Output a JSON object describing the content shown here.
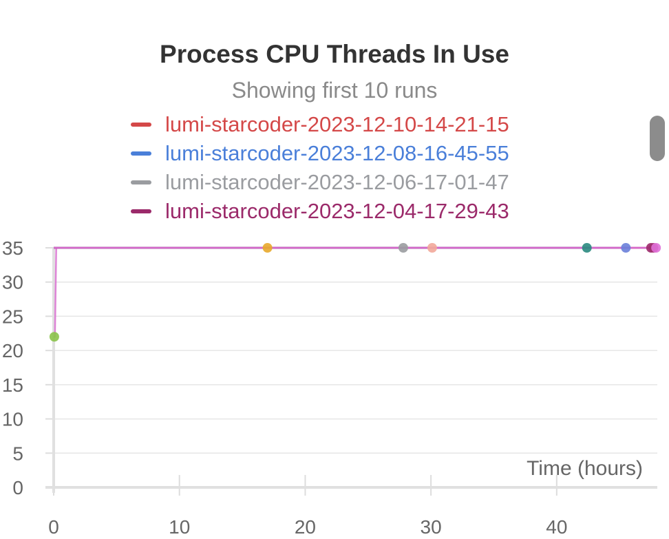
{
  "chart_data": {
    "type": "line",
    "title": "Process CPU Threads In Use",
    "subtitle": "Showing first 10 runs",
    "xlabel": "Time (hours)",
    "ylabel": "",
    "xlim": [
      0,
      48
    ],
    "ylim": [
      0,
      35
    ],
    "x_ticks": [
      0,
      10,
      20,
      30,
      40
    ],
    "y_ticks": [
      0,
      5,
      10,
      15,
      20,
      25,
      30,
      35
    ],
    "grid": true,
    "legend": [
      {
        "name": "lumi-starcoder-2023-12-10-14-21-15",
        "color": "#d44848"
      },
      {
        "name": "lumi-starcoder-2023-12-08-16-45-55",
        "color": "#4a7fd9"
      },
      {
        "name": "lumi-starcoder-2023-12-06-17-01-47",
        "color": "#9a9ca0"
      },
      {
        "name": "lumi-starcoder-2023-12-04-17-29-43",
        "color": "#9b2a6a"
      }
    ],
    "series": [
      {
        "color": "#d86fd0",
        "x": [
          0,
          0.1,
          0.2,
          48
        ],
        "y": [
          22,
          22,
          35,
          35
        ]
      },
      {
        "color": "#8bc34a",
        "x": [
          0,
          0.05
        ],
        "y": [
          22,
          22
        ]
      },
      {
        "color": "#e8a92b",
        "x": [
          0,
          17
        ],
        "y": [
          35,
          35
        ]
      },
      {
        "color": "#9a9ca0",
        "x": [
          0,
          27.8
        ],
        "y": [
          35,
          35
        ]
      },
      {
        "color": "#f2a99a",
        "x": [
          0,
          30.1
        ],
        "y": [
          35,
          35
        ]
      },
      {
        "color": "#2a8a80",
        "x": [
          0,
          42.4
        ],
        "y": [
          35,
          35
        ]
      },
      {
        "color": "#6a80d9",
        "x": [
          0,
          45.5
        ],
        "y": [
          35,
          35
        ]
      },
      {
        "color": "#9b2a6a",
        "x": [
          0,
          47.5
        ],
        "y": [
          35,
          35
        ]
      },
      {
        "color": "#e070d8",
        "x": [
          0,
          47.9
        ],
        "y": [
          35,
          35
        ]
      }
    ],
    "endpoints": [
      {
        "x": 0.05,
        "y": 22,
        "color": "#8bc34a"
      },
      {
        "x": 17,
        "y": 35,
        "color": "#e8a92b"
      },
      {
        "x": 27.8,
        "y": 35,
        "color": "#9a9ca0"
      },
      {
        "x": 30.1,
        "y": 35,
        "color": "#f2a99a"
      },
      {
        "x": 42.4,
        "y": 35,
        "color": "#2a8a80"
      },
      {
        "x": 45.5,
        "y": 35,
        "color": "#6a80d9"
      },
      {
        "x": 47.5,
        "y": 35,
        "color": "#9b2a6a"
      },
      {
        "x": 47.7,
        "y": 35,
        "color": "#a0306f"
      },
      {
        "x": 47.9,
        "y": 35,
        "color": "#e070d8"
      }
    ]
  }
}
